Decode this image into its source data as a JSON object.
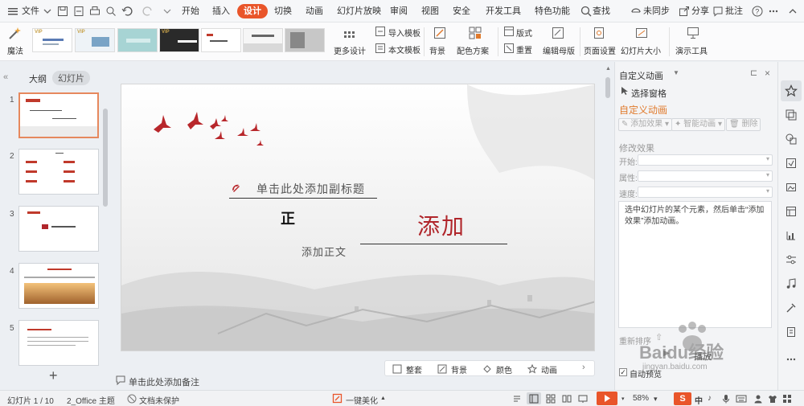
{
  "colors": {
    "accent": "#e9552a",
    "panel_title": "#e07a2c",
    "slide_title": "#b0262b"
  },
  "menubar": {
    "file": "文件",
    "tabs": [
      "开始",
      "插入",
      "设计",
      "切换",
      "动画",
      "幻灯片放映",
      "审阅",
      "视图",
      "安全",
      "开发工具",
      "特色功能"
    ],
    "active_tab": "设计",
    "search": "查找",
    "sync": "未同步",
    "share": "分享",
    "comment": "批注"
  },
  "ribbon": {
    "magic": "魔法",
    "vip": "VIP",
    "more_design": "更多设计",
    "import_template": "导入模板",
    "text_template": "本文模板",
    "background": "背景",
    "color_scheme": "配色方案",
    "layout": "版式",
    "reset": "重置",
    "edit_master": "编辑母版",
    "page_setup": "页面设置",
    "slide_size": "幻灯片大小",
    "presentation_tools": "演示工具"
  },
  "left_panel": {
    "tab_outline": "大纲",
    "tab_slides": "幻灯片",
    "slide_numbers": [
      "1",
      "2",
      "3",
      "4",
      "5"
    ],
    "add": "+"
  },
  "slide": {
    "subtitle": "单击此处添加副标题",
    "char_zheng": "正",
    "title": "添加",
    "body": "添加正文"
  },
  "notes_placeholder": "单击此处添加备注",
  "bottom_toolbar": [
    "整套",
    "背景",
    "颜色",
    "动画"
  ],
  "right_panel": {
    "header": "自定义动画",
    "select_pane": "选择窗格",
    "title": "自定义动画",
    "add_effect": "添加效果",
    "smart_anim": "智能动画",
    "delete": "删除",
    "modify_effect": "修改效果",
    "start_label": "开始:",
    "property_label": "属性:",
    "speed_label": "速度:",
    "hint": "选中幻灯片的某个元素，然后单击“添加效果”添加动画。",
    "reorder": "重新排序",
    "play": "播放",
    "auto_preview": "自动预览"
  },
  "statusbar": {
    "slide_info": "幻灯片 1 / 10",
    "theme": "2_Office 主题",
    "protect": "文档未保护",
    "beautify": "一键美化",
    "zoom": "58%",
    "lang": "中"
  },
  "watermark": {
    "logo": "Baidu经验",
    "url": "jingyan.baidu.com"
  }
}
